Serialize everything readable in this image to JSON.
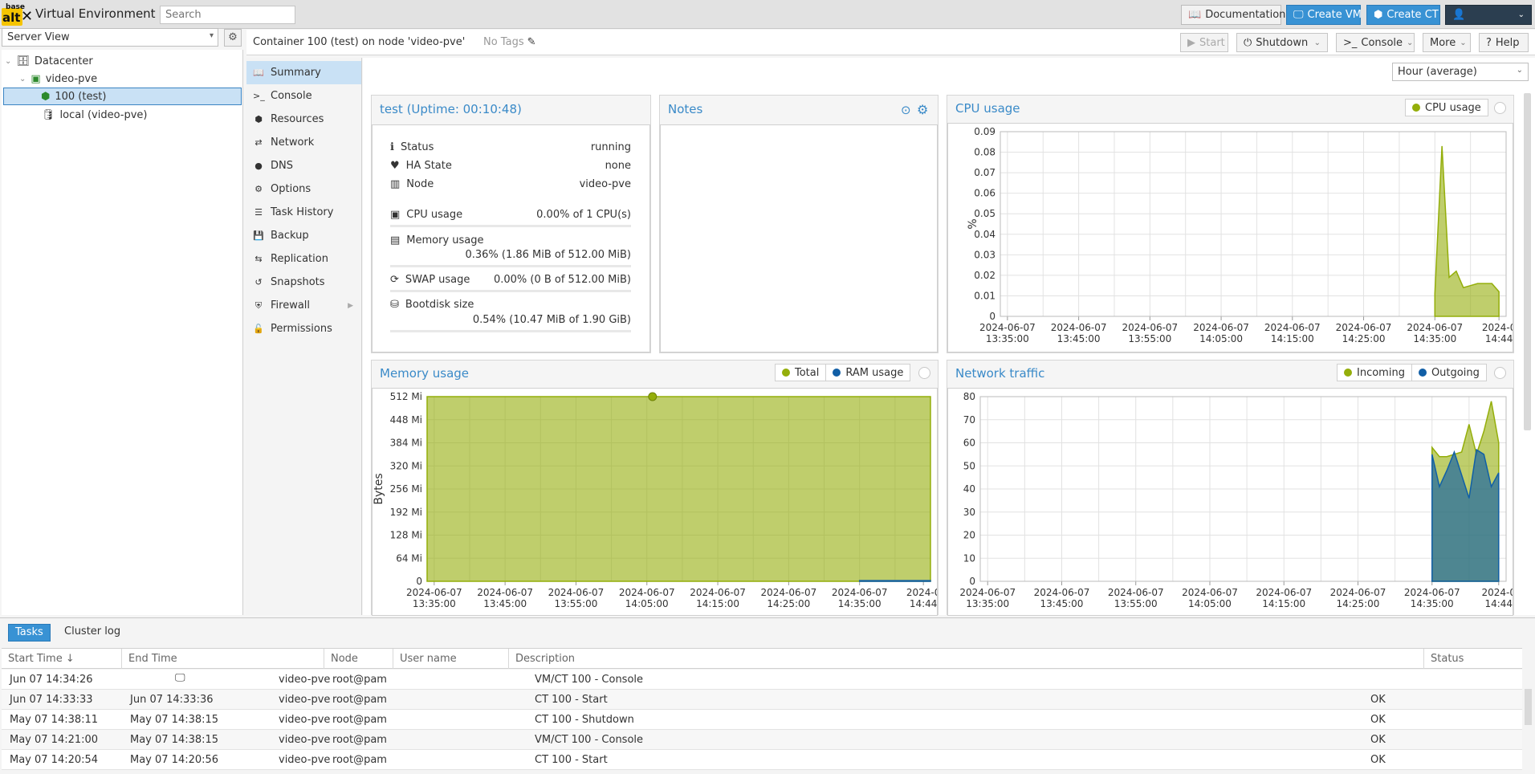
{
  "topbar": {
    "logo_top": "base",
    "logo_main": "alt",
    "title": "Virtual Environment",
    "search_placeholder": "Search",
    "documentation": "Documentation",
    "create_vm": "Create VM",
    "create_ct": "Create CT"
  },
  "tree": {
    "view": "Server View",
    "items": [
      {
        "label": "Datacenter"
      },
      {
        "label": "video-pve"
      },
      {
        "label": "100 (test)"
      },
      {
        "label": "local (video-pve)"
      }
    ]
  },
  "header": {
    "title": "Container 100 (test) on node 'video-pve'",
    "tags": "No Tags",
    "start": "Start",
    "shutdown": "Shutdown",
    "console": "Console",
    "more": "More",
    "help": "Help"
  },
  "subnav": [
    {
      "label": "Summary",
      "icon": "book-icon"
    },
    {
      "label": "Console",
      "icon": "terminal-icon"
    },
    {
      "label": "Resources",
      "icon": "cube-icon"
    },
    {
      "label": "Network",
      "icon": "exchange-icon"
    },
    {
      "label": "DNS",
      "icon": "globe-icon"
    },
    {
      "label": "Options",
      "icon": "gear-icon"
    },
    {
      "label": "Task History",
      "icon": "list-icon"
    },
    {
      "label": "Backup",
      "icon": "floppy-icon"
    },
    {
      "label": "Replication",
      "icon": "retweet-icon"
    },
    {
      "label": "Snapshots",
      "icon": "history-icon"
    },
    {
      "label": "Firewall",
      "icon": "shield-icon"
    },
    {
      "label": "Permissions",
      "icon": "unlock-icon"
    }
  ],
  "timeframe": "Hour (average)",
  "status_panel": {
    "title": "test (Uptime: 00:10:48)",
    "status_label": "Status",
    "status_value": "running",
    "ha_label": "HA State",
    "ha_value": "none",
    "node_label": "Node",
    "node_value": "video-pve",
    "cpu_label": "CPU usage",
    "cpu_value": "0.00% of 1 CPU(s)",
    "mem_label": "Memory usage",
    "mem_value": "0.36% (1.86 MiB of 512.00 MiB)",
    "swap_label": "SWAP usage",
    "swap_value": "0.00% (0 B of 512.00 MiB)",
    "disk_label": "Bootdisk size",
    "disk_value": "0.54% (10.47 MiB of 1.90 GiB)"
  },
  "notes_panel": {
    "title": "Notes"
  },
  "x_ticks": [
    [
      "2024-06-07",
      "13:35:00"
    ],
    [
      "2024-06-07",
      "13:45:00"
    ],
    [
      "2024-06-07",
      "13:55:00"
    ],
    [
      "2024-06-07",
      "14:05:00"
    ],
    [
      "2024-06-07",
      "14:15:00"
    ],
    [
      "2024-06-07",
      "14:25:00"
    ],
    [
      "2024-06-07",
      "14:35:00"
    ],
    [
      "2024-0",
      "14:44"
    ]
  ],
  "chart_data": [
    {
      "type": "area",
      "title": "CPU usage",
      "ylabel": "%",
      "ylim": [
        0,
        0.09
      ],
      "yticks": [
        "0",
        "0.01",
        "0.02",
        "0.03",
        "0.04",
        "0.05",
        "0.06",
        "0.07",
        "0.08",
        "0.09"
      ],
      "series": [
        {
          "name": "CPU usage",
          "color": "#94ae0a",
          "x": [
            "14:35",
            "14:36",
            "14:37",
            "14:38",
            "14:39",
            "14:40",
            "14:41",
            "14:42",
            "14:43",
            "14:44"
          ],
          "values": [
            0.011,
            0.083,
            0.019,
            0.022,
            0.014,
            0.015,
            0.016,
            0.016,
            0.016,
            0.012
          ]
        }
      ]
    },
    {
      "type": "area",
      "title": "Memory usage",
      "ylabel": "Bytes",
      "ylim": [
        0,
        512
      ],
      "yticks": [
        "0",
        "64 Mi",
        "128 Mi",
        "192 Mi",
        "256 Mi",
        "320 Mi",
        "384 Mi",
        "448 Mi",
        "512 Mi"
      ],
      "series": [
        {
          "name": "Total",
          "color": "#94ae0a",
          "x": [
            "13:34",
            "14:45"
          ],
          "values": [
            512,
            512
          ]
        },
        {
          "name": "RAM usage",
          "color": "#115fa6",
          "x": [
            "14:35",
            "14:45"
          ],
          "values": [
            1.86,
            1.86
          ]
        }
      ]
    },
    {
      "type": "area",
      "title": "Network traffic",
      "ylim": [
        0,
        80
      ],
      "yticks": [
        "0",
        "10",
        "20",
        "30",
        "40",
        "50",
        "60",
        "70",
        "80"
      ],
      "series": [
        {
          "name": "Incoming",
          "color": "#94ae0a",
          "x": [
            "14:35",
            "14:36",
            "14:37",
            "14:38",
            "14:39",
            "14:40",
            "14:41",
            "14:42",
            "14:43",
            "14:44"
          ],
          "values": [
            58,
            54,
            54,
            55,
            56,
            68,
            55,
            65,
            78,
            60
          ]
        },
        {
          "name": "Outgoing",
          "color": "#115fa6",
          "x": [
            "14:35",
            "14:36",
            "14:37",
            "14:38",
            "14:39",
            "14:40",
            "14:41",
            "14:42",
            "14:43",
            "14:44"
          ],
          "values": [
            55,
            41,
            48,
            56,
            46,
            36,
            57,
            55,
            41,
            47
          ]
        }
      ]
    }
  ],
  "bottom": {
    "tab_tasks": "Tasks",
    "tab_cluster": "Cluster log",
    "columns": [
      "Start Time",
      "End Time",
      "Node",
      "User name",
      "Description",
      "Status"
    ],
    "rows": [
      {
        "start": "Jun 07 14:34:26",
        "end": "",
        "node": "video-pve",
        "user": "root@pam",
        "desc": "VM/CT 100 - Console",
        "status": ""
      },
      {
        "start": "Jun 07 14:33:33",
        "end": "Jun 07 14:33:36",
        "node": "video-pve",
        "user": "root@pam",
        "desc": "CT 100 - Start",
        "status": "OK"
      },
      {
        "start": "May 07 14:38:11",
        "end": "May 07 14:38:15",
        "node": "video-pve",
        "user": "root@pam",
        "desc": "CT 100 - Shutdown",
        "status": "OK"
      },
      {
        "start": "May 07 14:21:00",
        "end": "May 07 14:38:15",
        "node": "video-pve",
        "user": "root@pam",
        "desc": "VM/CT 100 - Console",
        "status": "OK"
      },
      {
        "start": "May 07 14:20:54",
        "end": "May 07 14:20:56",
        "node": "video-pve",
        "user": "root@pam",
        "desc": "CT 100 - Start",
        "status": "OK"
      }
    ]
  }
}
